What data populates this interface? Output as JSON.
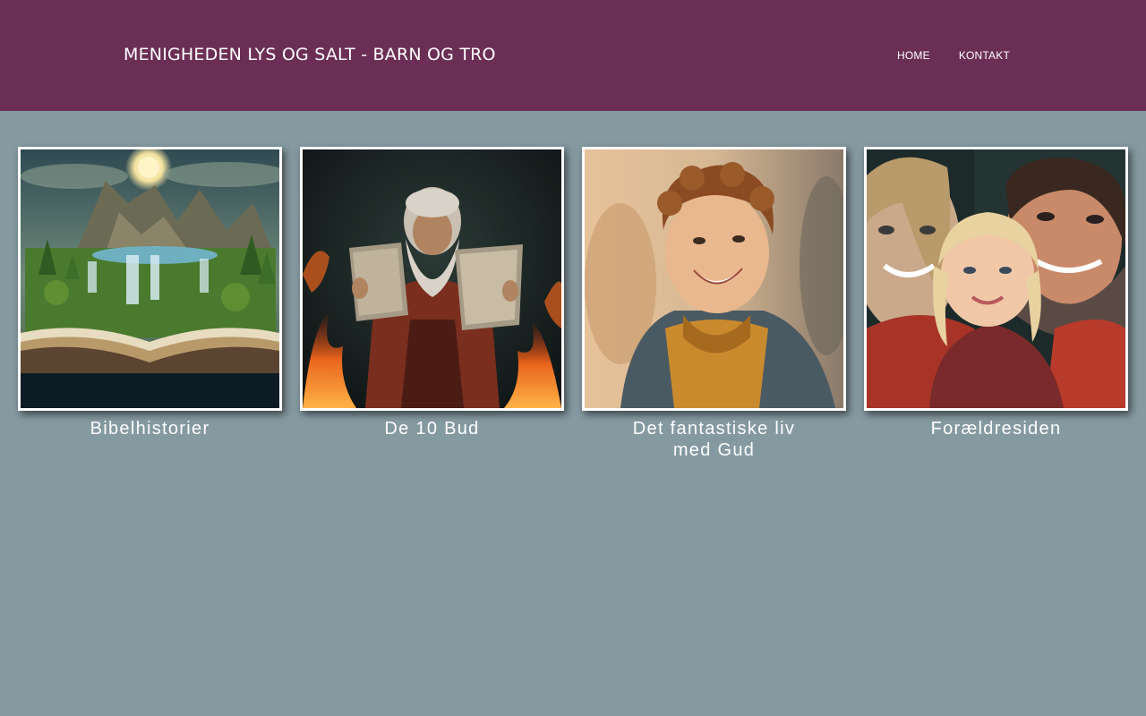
{
  "header": {
    "title": "MENIGHEDEN LYS OG SALT - BARN OG TRO",
    "background_color": "#6b2f55"
  },
  "nav": {
    "items": [
      {
        "label": "HOME"
      },
      {
        "label": "KONTAKT"
      }
    ]
  },
  "page": {
    "background_color": "#8599a1"
  },
  "gallery": {
    "items": [
      {
        "caption": "Bibelhistorier",
        "image": "open-book-landscape-image"
      },
      {
        "caption": "De 10 Bud",
        "image": "moses-tablets-image"
      },
      {
        "caption": "Det fantastiske liv med Gud",
        "image": "smiling-boy-image"
      },
      {
        "caption": "Forældresiden",
        "image": "family-selfie-image"
      }
    ]
  }
}
